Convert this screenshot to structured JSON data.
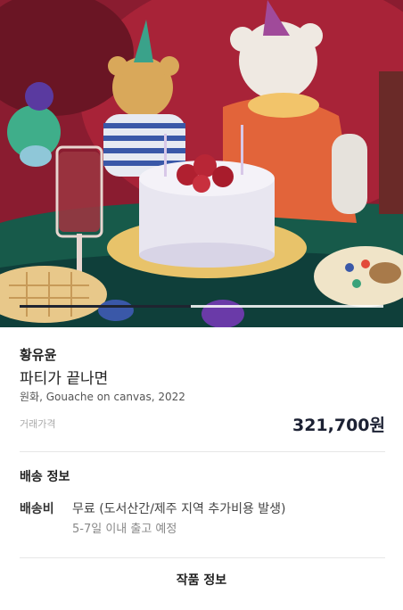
{
  "artwork": {
    "artist": "황유윤",
    "title": "파티가 끝나면",
    "meta": "원화, Gouache on canvas, 2022",
    "price_label": "거래가격",
    "price": "321,700원"
  },
  "gallery": {
    "progress_fraction": 0.47
  },
  "shipping": {
    "section_title": "배송 정보",
    "fee_label": "배송비",
    "fee_value": "무료 (도서산간/제주 지역 추가비용 발생)",
    "schedule": "5-7일 이내 출고 예정"
  },
  "bottom": {
    "tab_label": "작품 정보"
  },
  "colors": {
    "accent": "#1c2133",
    "divider": "#e6e6e6"
  }
}
